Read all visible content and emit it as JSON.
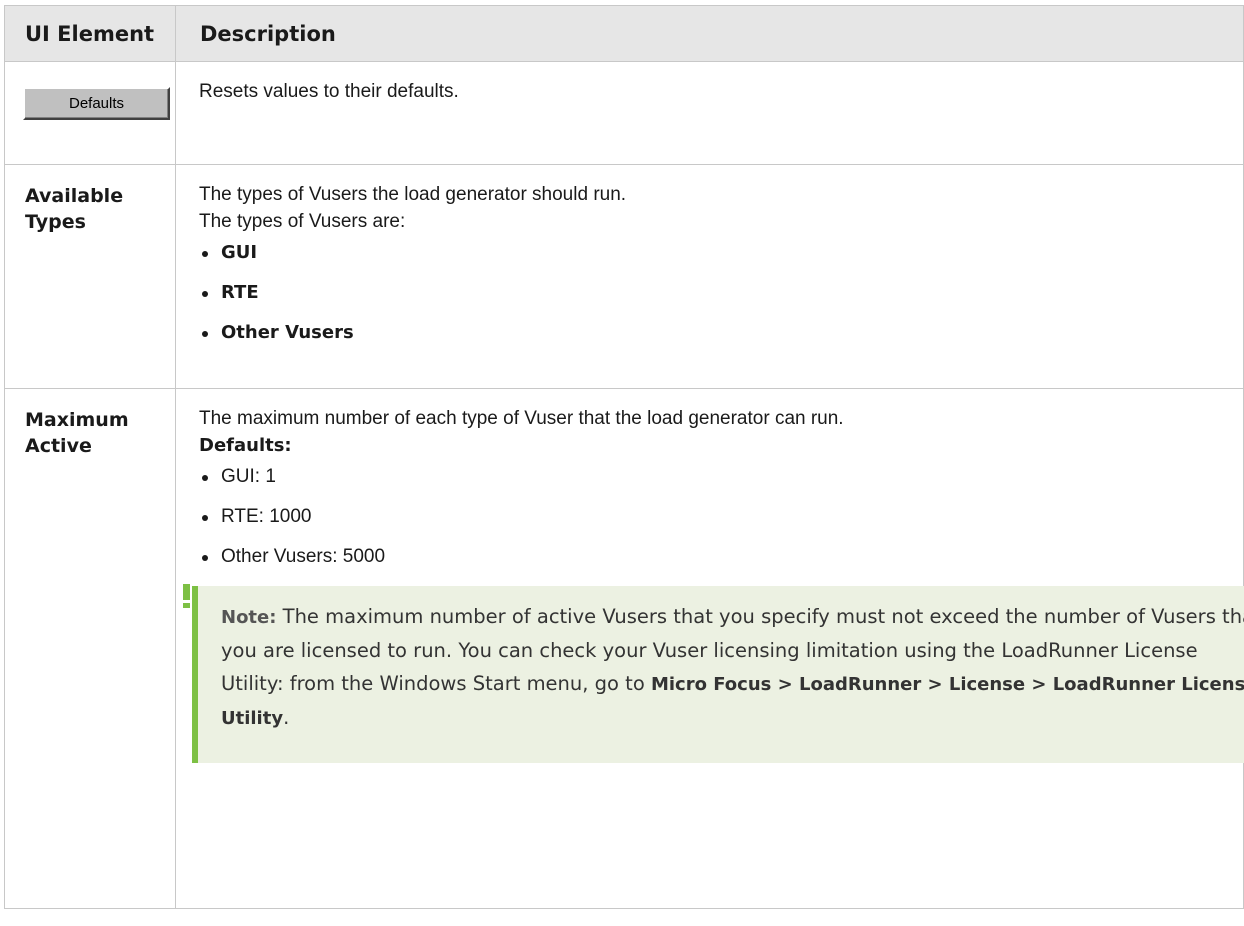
{
  "header": {
    "col_element": "UI Element",
    "col_description": "Description"
  },
  "rows": [
    {
      "element_button_label": "Defaults",
      "description": "Resets values to their defaults."
    },
    {
      "element_label": "Available Types",
      "description_line1": "The types of Vusers the load generator should run.",
      "description_line2": "The types of Vusers are:",
      "items": [
        "GUI",
        "RTE",
        "Other Vusers"
      ]
    },
    {
      "element_label": "Maximum Active",
      "description_line1": "The maximum number of each type of Vuser that the load generator can run.",
      "defaults_label": "Defaults:",
      "items": [
        "GUI: 1",
        "RTE: 1000",
        "Other Vusers: 5000"
      ],
      "note": {
        "label": "Note:",
        "text": "The maximum number of active Vusers that you specify must not exceed the number of Vusers that you are licensed to run. You can check your Vuser licensing limitation using the LoadRunner License Utility: from the Windows Start menu, go to",
        "path": "Micro Focus > LoadRunner > License > LoadRunner License Utility",
        "end": ".",
        "accent_color": "#7dc044",
        "background_color": "#ecf1e2",
        "icon": "exclamation-icon"
      }
    }
  ]
}
